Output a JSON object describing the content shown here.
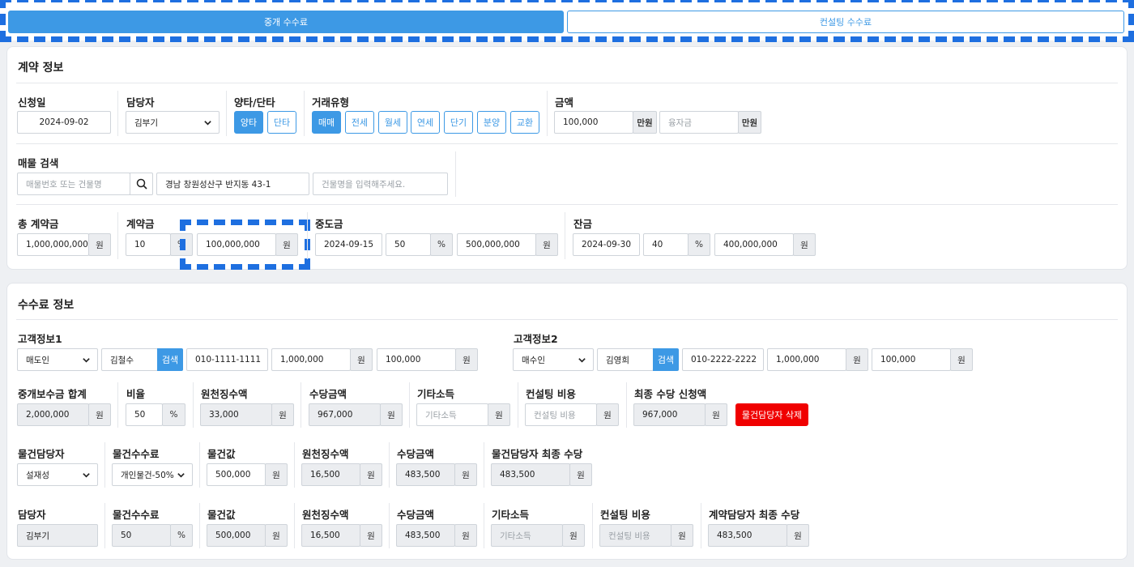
{
  "tabs": [
    {
      "label": "중개 수수료",
      "active": true
    },
    {
      "label": "컨설팅 수수료",
      "active": false
    }
  ],
  "contract": {
    "title": "계약 정보",
    "apply_date": {
      "label": "신청일",
      "value": "2024-09-02"
    },
    "manager": {
      "label": "담당자",
      "value": "김부기"
    },
    "side": {
      "label": "양타/단타",
      "options": [
        "양타",
        "단타"
      ],
      "selected": "양타"
    },
    "deal_type": {
      "label": "거래유형",
      "options": [
        "매매",
        "전세",
        "월세",
        "연세",
        "단기",
        "분양",
        "교환"
      ],
      "selected": "매매"
    },
    "amount": {
      "label": "금액",
      "value": "100,000",
      "unit": "만원",
      "loan_placeholder": "융자금",
      "loan_unit": "만원"
    },
    "property_search": {
      "label": "매물 검색",
      "placeholder": "매물번호 또는 건물명",
      "address": "경남 창원성산구 반지동 43-1",
      "building_placeholder": "건물명을 입력해주세요."
    },
    "total": {
      "label": "총 계약금",
      "value": "1,000,000,000",
      "unit": "원"
    },
    "deposit": {
      "label": "계약금",
      "percent": "10",
      "percent_unit": "%",
      "value": "100,000,000",
      "unit": "원"
    },
    "middle": {
      "label": "중도금",
      "date": "2024-09-15",
      "percent": "50",
      "percent_unit": "%",
      "value": "500,000,000",
      "unit": "원"
    },
    "balance": {
      "label": "잔금",
      "date": "2024-09-30",
      "percent": "40",
      "percent_unit": "%",
      "value": "400,000,000",
      "unit": "원"
    }
  },
  "fee": {
    "title": "수수료 정보",
    "search_label": "검색",
    "customer1": {
      "label": "고객정보1",
      "role": "매도인",
      "name": "김철수",
      "phone": "010-1111-1111",
      "amount1": "1,000,000",
      "amount2": "100,000",
      "unit": "원"
    },
    "customer2": {
      "label": "고객정보2",
      "role": "매수인",
      "name": "김영희",
      "phone": "010-2222-2222",
      "amount1": "1,000,000",
      "amount2": "100,000",
      "unit": "원"
    },
    "row1": {
      "total": {
        "label": "중개보수금 합계",
        "value": "2,000,000",
        "unit": "원"
      },
      "ratio": {
        "label": "비율",
        "value": "50",
        "unit": "%"
      },
      "withholding": {
        "label": "원천징수액",
        "value": "33,000",
        "unit": "원"
      },
      "allowance": {
        "label": "수당금액",
        "value": "967,000",
        "unit": "원"
      },
      "other": {
        "label": "기타소득",
        "placeholder": "기타소득",
        "unit": "원"
      },
      "consulting": {
        "label": "컨설팅 비용",
        "placeholder": "컨설팅 비용",
        "unit": "원"
      },
      "final": {
        "label": "최종 수당 신청액",
        "value": "967,000",
        "unit": "원"
      },
      "delete_label": "물건담당자 삭제"
    },
    "row2": {
      "person": {
        "label": "물건담당자",
        "value": "설재성"
      },
      "fee": {
        "label": "물건수수료",
        "value": "개인물건-50%"
      },
      "price": {
        "label": "물건값",
        "value": "500,000",
        "unit": "원"
      },
      "withholding": {
        "label": "원천징수액",
        "value": "16,500",
        "unit": "원"
      },
      "allowance": {
        "label": "수당금액",
        "value": "483,500",
        "unit": "원"
      },
      "final": {
        "label": "물건담당자 최종 수당",
        "value": "483,500",
        "unit": "원"
      }
    },
    "row3": {
      "person": {
        "label": "담당자",
        "value": "김부기"
      },
      "fee": {
        "label": "물건수수료",
        "value": "50",
        "unit": "%"
      },
      "price": {
        "label": "물건값",
        "value": "500,000",
        "unit": "원"
      },
      "withholding": {
        "label": "원천징수액",
        "value": "16,500",
        "unit": "원"
      },
      "allowance": {
        "label": "수당금액",
        "value": "483,500",
        "unit": "원"
      },
      "other": {
        "label": "기타소득",
        "placeholder": "기타소득",
        "unit": "원"
      },
      "consulting": {
        "label": "컨설팅 비용",
        "placeholder": "컨설팅 비용",
        "unit": "원"
      },
      "final": {
        "label": "계약담당자 최종 수당",
        "value": "483,500",
        "unit": "원"
      }
    }
  },
  "colors": {
    "accent": "#3d99e5",
    "danger": "#f00000",
    "highlight": "#1e6fe0"
  }
}
